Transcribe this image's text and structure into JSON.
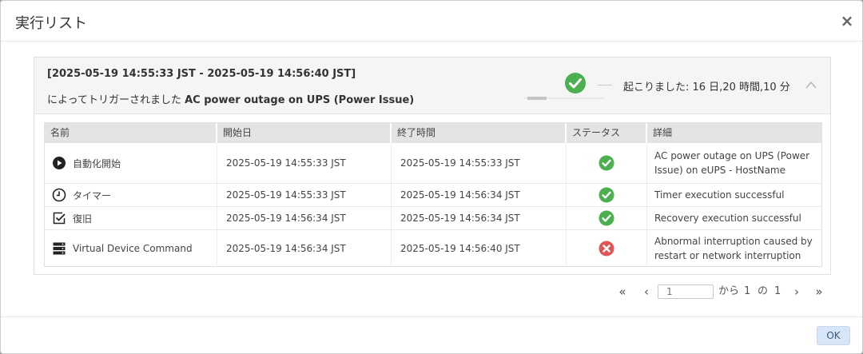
{
  "dialog": {
    "title": "実行リスト",
    "close_label": "×",
    "ok_label": "OK"
  },
  "run": {
    "range": "[2025-05-19 14:55:33 JST - 2025-05-19 14:56:40 JST]",
    "trigger_prefix": "によってトリガーされました",
    "trigger_event": "AC power outage on UPS (Power Issue)",
    "occurred": "起こりました: 16 日,20 時間,10 分",
    "status_icon": "check-circle-icon",
    "success_color": "#4caf50"
  },
  "table": {
    "headers": {
      "name": "名前",
      "start": "開始日",
      "end": "終了時間",
      "status": "ステータス",
      "detail": "詳細"
    },
    "rows": [
      {
        "icon": "play-circle-icon",
        "name": "自動化開始",
        "start": "2025-05-19 14:55:33 JST",
        "end": "2025-05-19 14:55:33 JST",
        "status": "success",
        "detail": "AC power outage on UPS (Power Issue) on eUPS - HostName"
      },
      {
        "icon": "clock-icon",
        "name": "タイマー",
        "start": "2025-05-19 14:55:33 JST",
        "end": "2025-05-19 14:56:34 JST",
        "status": "success",
        "detail": "Timer execution successful"
      },
      {
        "icon": "checkbox-icon",
        "name": "復旧",
        "start": "2025-05-19 14:56:34 JST",
        "end": "2025-05-19 14:56:34 JST",
        "status": "success",
        "detail": "Recovery execution successful"
      },
      {
        "icon": "server-icon",
        "name": "Virtual Device Command",
        "start": "2025-05-19 14:56:34 JST",
        "end": "2025-05-19 14:56:40 JST",
        "status": "error",
        "detail": "Abnormal interruption caused by restart or network interruption"
      }
    ]
  },
  "pager": {
    "first": "«",
    "prev": "‹",
    "next": "›",
    "last": "»",
    "page_placeholder": "1",
    "from_label": "から",
    "current": "1",
    "of_label": "の",
    "total": "1"
  },
  "colors": {
    "success": "#4caf50",
    "error": "#e05555"
  }
}
